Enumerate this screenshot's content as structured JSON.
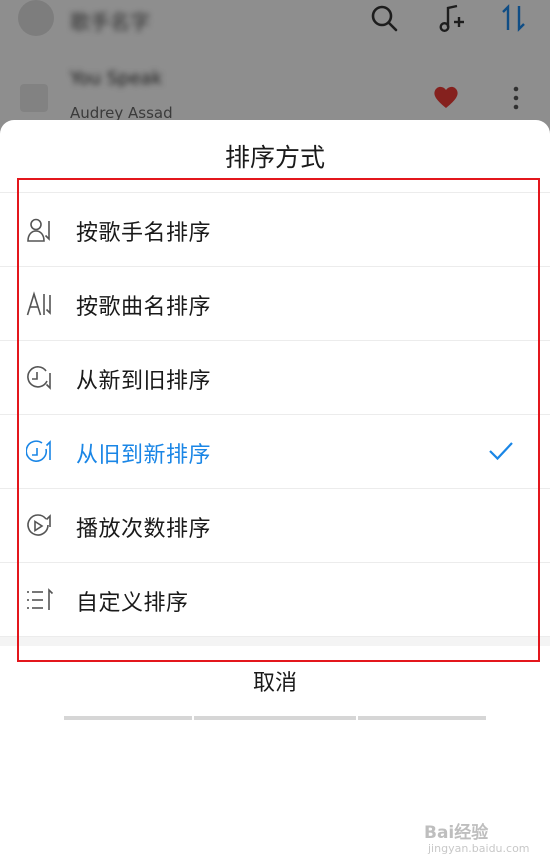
{
  "background": {
    "header_title": "歌手名字",
    "song_title": "You Speak",
    "song_artist": "Audrey Assad",
    "accent_heart": "#e53935"
  },
  "sheet": {
    "title": "排序方式",
    "items": [
      {
        "label": "按歌手名排序",
        "icon": "artist-sort-icon",
        "active": false
      },
      {
        "label": "按歌曲名排序",
        "icon": "title-sort-icon",
        "active": false
      },
      {
        "label": "从新到旧排序",
        "icon": "clock-down-icon",
        "active": false
      },
      {
        "label": "从旧到新排序",
        "icon": "clock-up-icon",
        "active": true
      },
      {
        "label": "播放次数排序",
        "icon": "play-count-icon",
        "active": false
      },
      {
        "label": "自定义排序",
        "icon": "custom-sort-icon",
        "active": false
      }
    ],
    "cancel_label": "取消",
    "accent": "#1a86e6",
    "highlight_color": "#e3161c"
  },
  "watermark": {
    "brand": "Bai经验",
    "sub": "jingyan.baidu.com"
  }
}
